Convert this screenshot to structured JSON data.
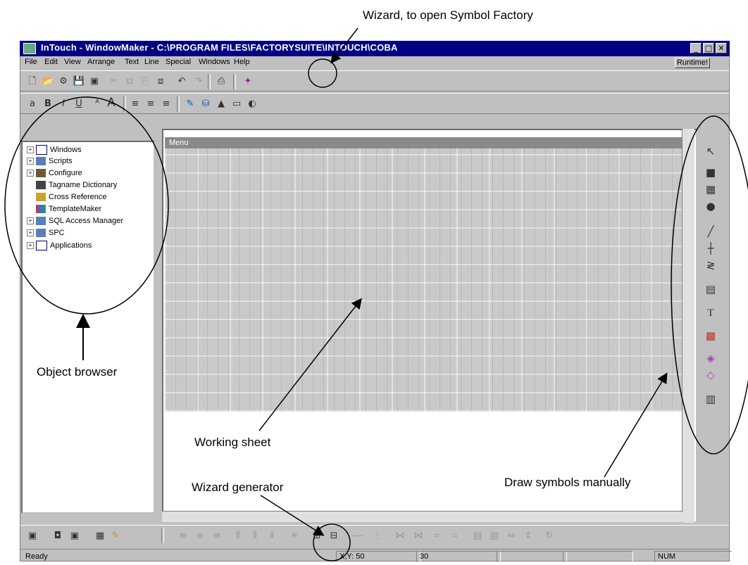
{
  "window": {
    "title": "InTouch - WindowMaker - C:\\PROGRAM FILES\\FACTORYSUITE\\INTOUCH\\COBA",
    "buttons": {
      "minimize": "_",
      "maximize": "□",
      "close": "✕"
    }
  },
  "menubar": {
    "items": [
      "File",
      "Edit",
      "View",
      "Arrange",
      "Text",
      "Line",
      "Special",
      "Windows",
      "Help"
    ],
    "runtime_label": "Runtime!"
  },
  "tree": {
    "items": [
      {
        "label": "Windows",
        "icon": "window-icon"
      },
      {
        "label": "Scripts",
        "icon": "script-icon"
      },
      {
        "label": "Configure",
        "icon": "configure-icon"
      },
      {
        "label": "Tagname Dictionary",
        "icon": "dictionary-icon"
      },
      {
        "label": "Cross Reference",
        "icon": "cross-reference-icon"
      },
      {
        "label": "TemplateMaker",
        "icon": "template-icon"
      },
      {
        "label": "SQL Access Manager",
        "icon": "sql-icon"
      },
      {
        "label": "SPC",
        "icon": "spc-icon"
      },
      {
        "label": "Applications",
        "icon": "applications-icon"
      }
    ]
  },
  "sheet": {
    "title": "Menu"
  },
  "status": {
    "ready": "Ready",
    "xy": "X,Y: 50",
    "value": "30",
    "num": "NUM"
  },
  "annotations": {
    "wizard_symbol_factory": "Wizard, to open Symbol Factory",
    "object_browser": "Object browser",
    "working_sheet": "Working sheet",
    "wizard_generator": "Wizard generator",
    "draw_symbols": "Draw symbols manually"
  },
  "colors": {
    "titlebar": "#000080",
    "face": "#c0c0c0",
    "sheet": "#c9c9c9"
  }
}
